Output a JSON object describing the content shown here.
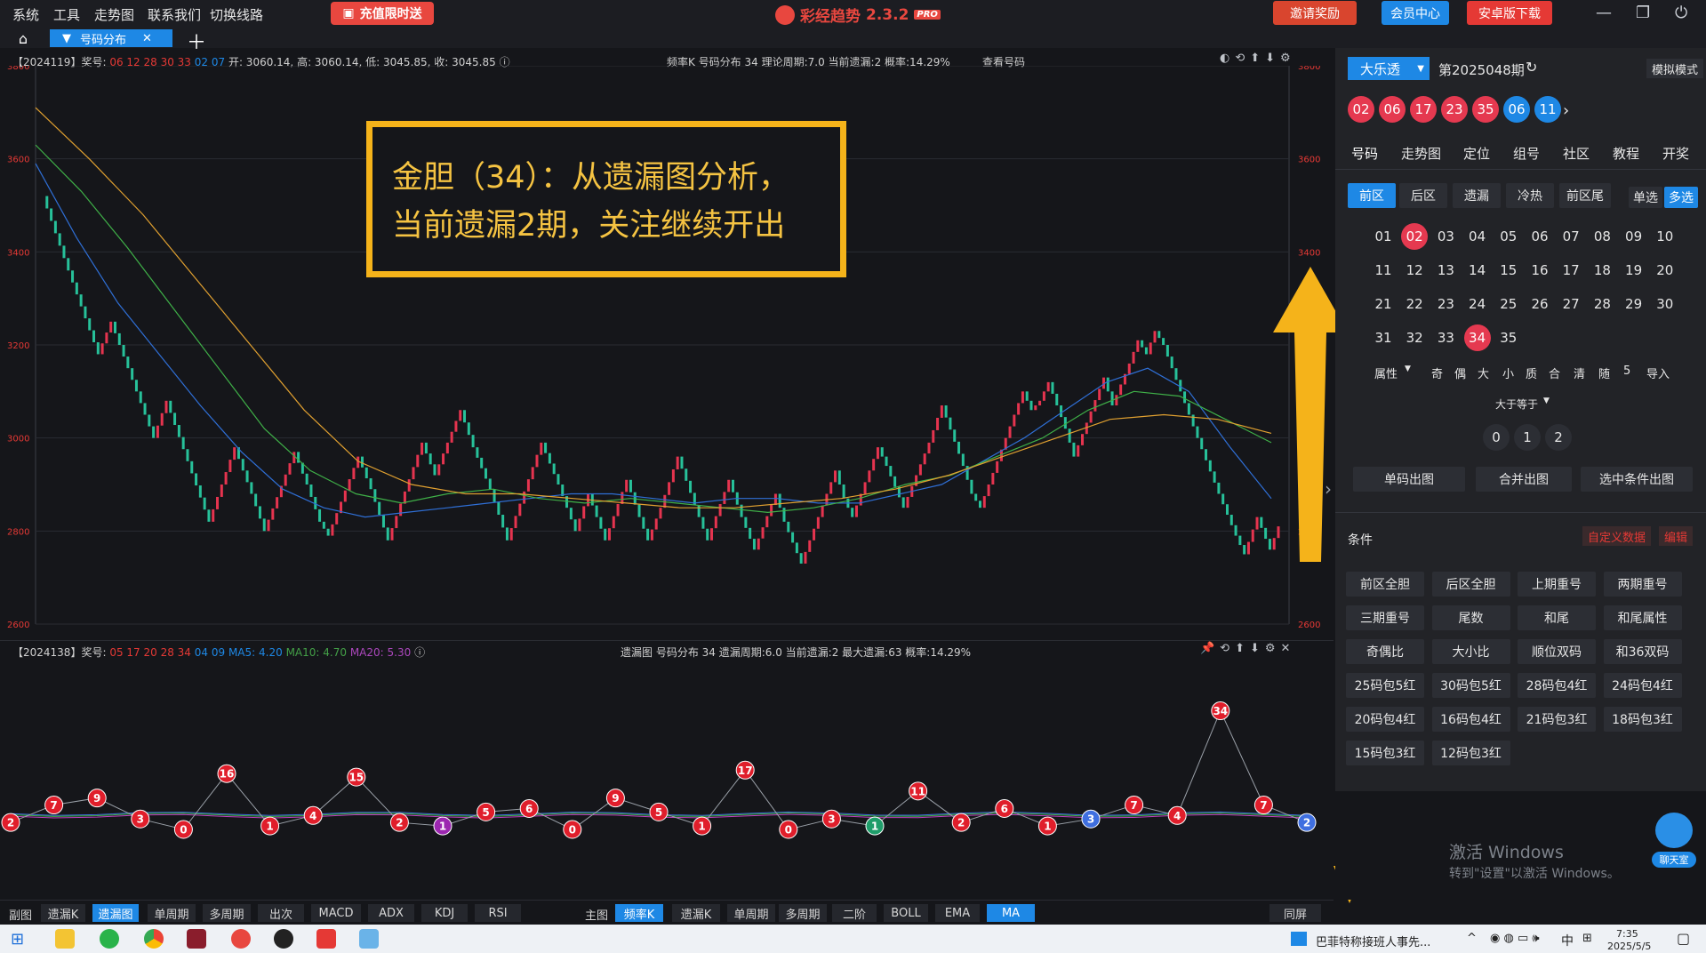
{
  "menu": [
    "系统",
    "工具",
    "走势图",
    "联系我们",
    "切换线路"
  ],
  "promo_label": "充值限时送",
  "app": {
    "name": "彩经趋势",
    "version": "2.3.2",
    "badge": "PRO"
  },
  "top_buttons": {
    "invite": "邀请奖励",
    "member": "会员中心",
    "android": "安卓版下载"
  },
  "tab": {
    "label": "号码分布"
  },
  "top_chart": {
    "info_left_prefix": "【2024119】奖号:",
    "info_front_numbers": "06 12 28 30 33",
    "info_back_numbers": "02 07",
    "info_ohlc": "开: 3060.14, 高: 3060.14, 低: 3045.85, 收: 3045.85",
    "info_mid": "频率K  号码分布  34    理论周期:7.0  当前遗漏:2  概率:14.29%",
    "info_right": "查看号码",
    "y_ticks": [
      "3800",
      "3600",
      "3400",
      "3200",
      "3000",
      "2800",
      "2600"
    ]
  },
  "annotation": {
    "line1": "金胆（34）：从遗漏图分析，",
    "line2": "当前遗漏2期，关注继续开出"
  },
  "bottom_chart": {
    "info_prefix": "【2024138】奖号:",
    "info_front_numbers": "05 17 20 28 34",
    "info_back_numbers": "04 09",
    "ma5": "MA5: 4.20",
    "ma10": "MA10: 4.70",
    "ma20": "MA20: 5.30",
    "info_mid": "遗漏图  号码分布  34    遗漏周期:6.0  当前遗漏:2  最大遗漏:63  概率:14.29%"
  },
  "chart_data": [
    {
      "type": "candlestick-with-ma",
      "title": "频率K 号码分布 34",
      "ylim": [
        2600,
        3800
      ],
      "y_ticks": [
        3800,
        3600,
        3400,
        3200,
        3000,
        2800,
        2600
      ],
      "close_path": [
        3520,
        3360,
        3180,
        3250,
        3150,
        3000,
        3080,
        2950,
        2820,
        2980,
        2880,
        2800,
        2970,
        2900,
        2820,
        2790,
        2960,
        2890,
        2780,
        2990,
        2920,
        3060,
        2980,
        2890,
        2780,
        2990,
        2900,
        2800,
        2880,
        2780,
        2910,
        2830,
        2780,
        2850,
        2960,
        2830,
        2780,
        2910,
        2830,
        2760,
        2880,
        2820,
        2730,
        2930,
        2870,
        2830,
        2980,
        2940,
        2850,
        2990,
        3070,
        2940,
        2880,
        2850,
        3100,
        3060,
        3080,
        3120,
        3020,
        2960,
        3130,
        3070,
        3160,
        3210,
        3180,
        3230,
        3200,
        3100,
        3000,
        2880,
        2790,
        2750,
        2830,
        2760,
        2810
      ],
      "ma_series": [
        {
          "name": "MA-a",
          "color": "#2f6fd6",
          "values": [
            3590,
            3430,
            3290,
            3180,
            3070,
            2970,
            2890,
            2850,
            2830,
            2840,
            2850,
            2860,
            2870,
            2880,
            2880,
            2870,
            2860,
            2870,
            2870,
            2860,
            2860,
            2880,
            2900,
            2950,
            3000,
            3060,
            3120,
            3150,
            3100,
            2980,
            2870
          ]
        },
        {
          "name": "MA-b",
          "color": "#3fb048",
          "values": [
            3630,
            3530,
            3410,
            3280,
            3150,
            3020,
            2930,
            2880,
            2860,
            2880,
            2890,
            2870,
            2860,
            2870,
            2860,
            2850,
            2840,
            2850,
            2870,
            2900,
            2920,
            2960,
            3000,
            3060,
            3100,
            3090,
            3040,
            2990
          ]
        },
        {
          "name": "MA-c",
          "color": "#e0a030",
          "values": [
            3710,
            3600,
            3480,
            3340,
            3200,
            3060,
            2950,
            2900,
            2880,
            2880,
            2870,
            2860,
            2850,
            2850,
            2860,
            2870,
            2890,
            2920,
            2960,
            3000,
            3040,
            3050,
            3040,
            3010
          ]
        }
      ]
    },
    {
      "type": "line",
      "title": "遗漏图 号码分布 34",
      "ylim": [
        0,
        40
      ],
      "values": [
        2,
        7,
        9,
        3,
        0,
        16,
        1,
        4,
        15,
        2,
        1,
        5,
        6,
        0,
        9,
        5,
        1,
        17,
        0,
        3,
        1,
        11,
        2,
        6,
        1,
        3,
        7,
        4,
        34,
        7,
        2
      ],
      "mark_colors": [
        "red",
        "red",
        "red",
        "red",
        "red",
        "red",
        "red",
        "red",
        "red",
        "red",
        "purple",
        "red",
        "red",
        "red",
        "red",
        "red",
        "red",
        "red",
        "red",
        "red",
        "green",
        "red",
        "red",
        "red",
        "red",
        "blue",
        "red",
        "red",
        "red",
        "red",
        "blue"
      ]
    }
  ],
  "bottom_toolbar": {
    "sub_label": "副图",
    "sub_buttons": [
      "遗漏K",
      "遗漏图",
      "单周期",
      "多周期",
      "出次",
      "MACD",
      "ADX",
      "KDJ",
      "RSI"
    ],
    "main_label": "主图",
    "main_buttons": [
      "频率K",
      "遗漏K",
      "单周期",
      "多周期",
      "二阶",
      "BOLL",
      "EMA",
      "MA"
    ],
    "sync_label": "同屏"
  },
  "right_panel": {
    "lottery_select": "大乐透",
    "period": "第2025048期",
    "mode": "模拟模式",
    "draw_front": [
      "02",
      "06",
      "17",
      "23",
      "35"
    ],
    "draw_back": [
      "06",
      "11"
    ],
    "tabs": [
      "号码",
      "走势图",
      "定位",
      "组号",
      "社区",
      "教程",
      "开奖"
    ],
    "segments": [
      "前区",
      "后区",
      "遗漏",
      "冷热",
      "前区尾"
    ],
    "single": "单选",
    "multi": "多选",
    "numbers": [
      "01",
      "02",
      "03",
      "04",
      "05",
      "06",
      "07",
      "08",
      "09",
      "10",
      "11",
      "12",
      "13",
      "14",
      "15",
      "16",
      "17",
      "18",
      "19",
      "20",
      "21",
      "22",
      "23",
      "24",
      "25",
      "26",
      "27",
      "28",
      "29",
      "30",
      "31",
      "32",
      "33",
      "34",
      "35"
    ],
    "selected": [
      "02",
      "34"
    ],
    "attr_select": "属性",
    "attr_items": [
      "奇",
      "偶",
      "大",
      "小",
      "质",
      "合",
      "清",
      "随",
      "5",
      "导入"
    ],
    "compare_select": "大于等于",
    "compare_values": [
      "0",
      "1",
      "2"
    ],
    "actions": [
      "单码出图",
      "合并出图",
      "选中条件出图"
    ],
    "conditions_title": "条件",
    "custom_data": "自定义数据",
    "edit": "编辑",
    "conditions": [
      "前区全胆",
      "后区全胆",
      "上期重号",
      "两期重号",
      "三期重号",
      "尾数",
      "和尾",
      "和尾属性",
      "奇偶比",
      "大小比",
      "顺位双码",
      "和36双码",
      "25码包5红",
      "30码包5红",
      "28码包4红",
      "24码包4红",
      "20码包4红",
      "16码包4红",
      "21码包3红",
      "18码包3红",
      "15码包3红",
      "12码包3红"
    ],
    "watermark1": "激活 Windows",
    "watermark2": "转到\"设置\"以激活 Windows。",
    "chat": "聊天室"
  },
  "taskbar": {
    "news": "巴菲特称接班人事先...",
    "ime": "中",
    "time": "7:35",
    "date": "2025/5/5"
  }
}
